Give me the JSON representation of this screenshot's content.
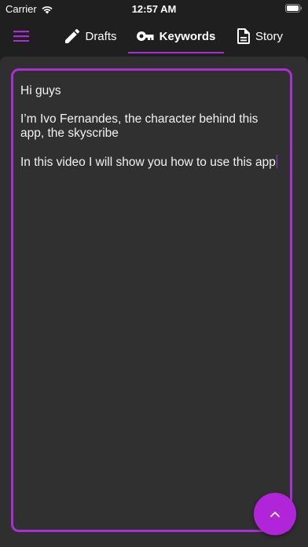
{
  "status_bar": {
    "carrier": "Carrier",
    "time": "12:57 AM",
    "icons": [
      "wifi-icon",
      "battery-icon"
    ]
  },
  "nav": {
    "menu_icon": "hamburger-menu-icon",
    "tabs": [
      {
        "label": "Drafts",
        "icon": "pencil-icon",
        "selected": false
      },
      {
        "label": "Keywords",
        "icon": "key-icon",
        "selected": true
      },
      {
        "label": "Story",
        "icon": "document-icon",
        "selected": false
      }
    ]
  },
  "editor": {
    "paragraphs": [
      "Hi guys",
      "I’m Ivo Fernandes, the character behind this app, the skyscribe",
      "In this video I will show you how to use this app"
    ]
  },
  "fab": {
    "icon": "chevron-up-icon"
  },
  "colors": {
    "accent": "#a82fd1",
    "fab": "#b025d8",
    "background": "#1f1f1f",
    "surface": "#2f2f2f",
    "text": "#f2f2f2"
  }
}
